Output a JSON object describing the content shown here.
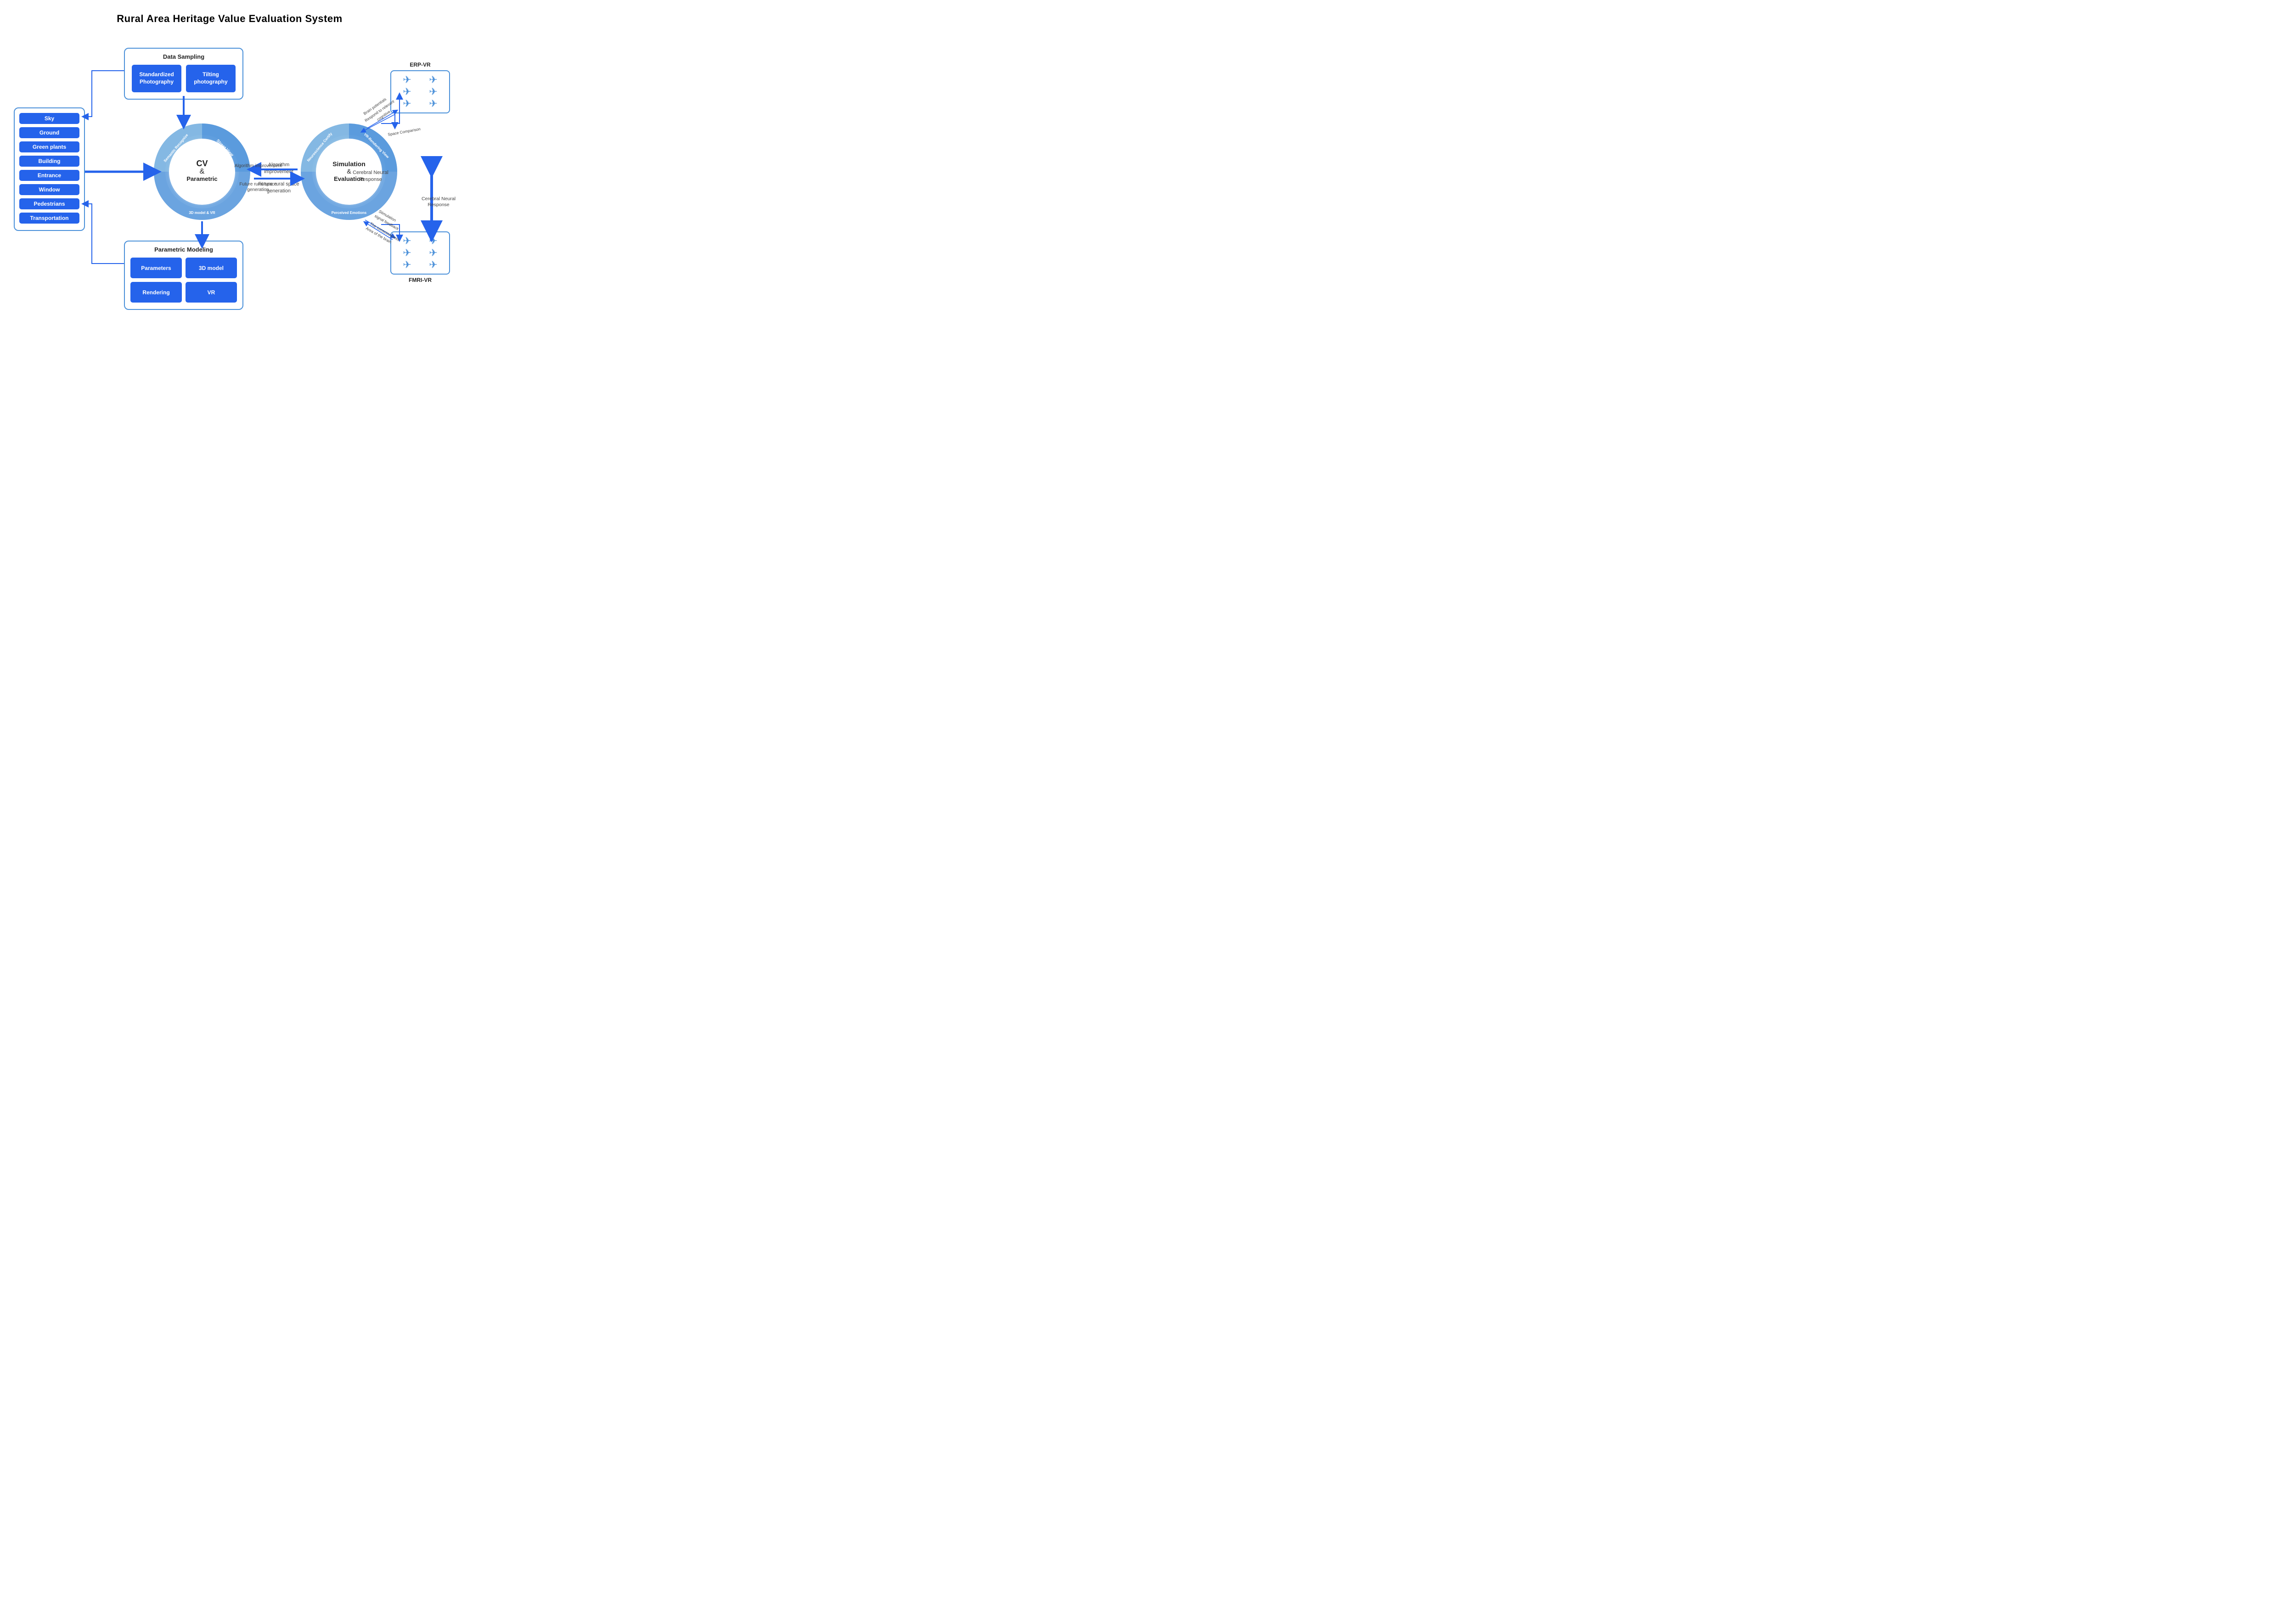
{
  "title": "Rural Area Heritage Value Evaluation System",
  "data_sampling": {
    "label": "Data Sampling",
    "btn1": "Standardized Photography",
    "btn2": "Tilting photography"
  },
  "left_items": {
    "items": [
      "Sky",
      "Ground",
      "Green plants",
      "Building",
      "Entrance",
      "Window",
      "Pedestrians",
      "Transportation"
    ]
  },
  "parametric": {
    "label": "Parametric Modeling",
    "btn1": "Parameters",
    "btn2": "3D model",
    "btn3": "Rendering",
    "btn4": "VR"
  },
  "center_circle": {
    "text": "CV\n&\nParametric",
    "labels": [
      "Street View",
      "Semantic Recognize",
      "3D model & VR"
    ]
  },
  "right_circle": {
    "text": "Simulation\n&\nEvaluation",
    "labels": [
      "VR-Rendering View",
      "Neuroscience Certify",
      "Perceived Emotions"
    ]
  },
  "algorithm": {
    "improvement": "Algorithm improvement",
    "future": "Future rural space generation"
  },
  "erp": {
    "label": "ERP-VR"
  },
  "fmri": {
    "label": "FMRI-VR"
  },
  "brain_text": "Brain potentials Respond to relevant cognitive",
  "space_text": "Space Comparison",
  "stim_text1": "Stimulation signal feedback",
  "stim_text2": "The consciousness Area of the brain",
  "cerebral_text": "Cerebral Neural Response"
}
